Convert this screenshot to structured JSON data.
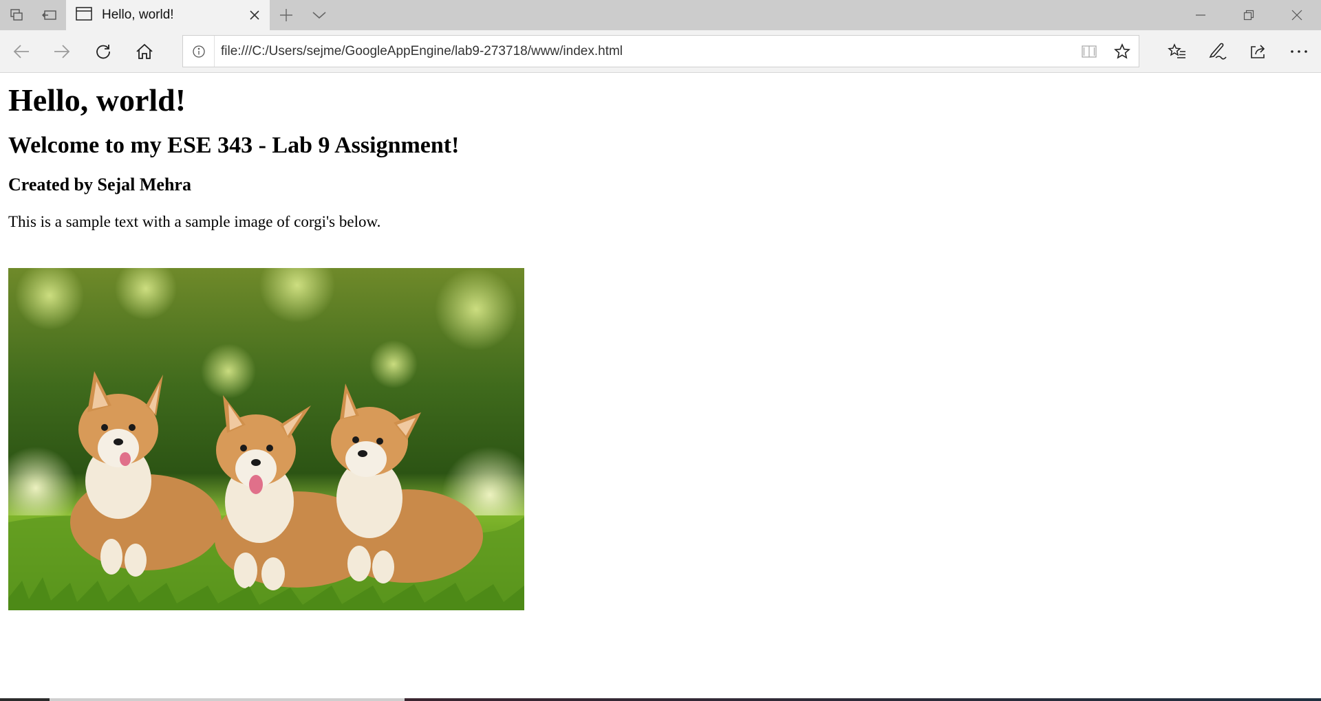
{
  "browser": {
    "tab": {
      "title": "Hello, world!"
    },
    "address": {
      "url": "file:///C:/Users/sejme/GoogleAppEngine/lab9-273718/www/index.html"
    },
    "icons": {
      "tab_preview": "tab-preview-icon",
      "set_aside": "set-aside-tabs-icon",
      "page": "page-icon",
      "close_tab": "close-icon",
      "new_tab": "plus-icon",
      "tab_list": "chevron-down-icon",
      "minimize": "minimize-icon",
      "restore": "restore-icon",
      "close_window": "close-icon",
      "back": "back-arrow-icon",
      "forward": "forward-arrow-icon",
      "refresh": "refresh-icon",
      "home": "home-icon",
      "site_info": "info-icon",
      "reading_view": "book-icon",
      "favorite": "star-icon",
      "favorites_hub": "favorites-list-icon",
      "notes": "pen-icon",
      "share": "share-icon",
      "more": "more-icon"
    }
  },
  "page": {
    "heading1": "Hello, world!",
    "heading2": "Welcome to my ESE 343 - Lab 9 Assignment!",
    "heading3": "Created by Sejal Mehra",
    "paragraph": "This is a sample text with a sample image of corgi's below.",
    "image": {
      "description_icon": "corgi-photo"
    }
  },
  "colors": {
    "titlebar": "#cccccc",
    "toolbar": "#f2f2f2",
    "page_background": "#ffffff",
    "text": "#000000"
  }
}
